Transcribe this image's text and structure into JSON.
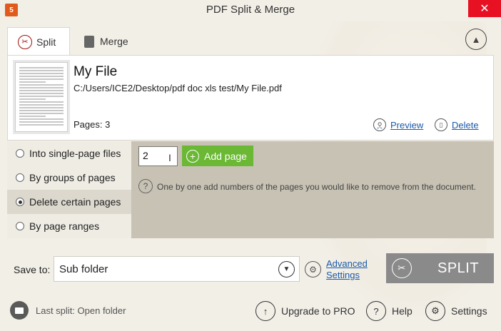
{
  "window": {
    "title": "PDF Split & Merge",
    "app_icon_label": "5"
  },
  "tabs": [
    {
      "label": "Split",
      "icon": "scissors-icon",
      "active": true
    },
    {
      "label": "Merge",
      "icon": "document-icon",
      "active": false
    }
  ],
  "file": {
    "name": "My File",
    "path": "C:/Users/ICE2/Desktop/pdf doc xls test/My File.pdf",
    "pages_label": "Pages: 3",
    "preview_label": "Preview",
    "delete_label": "Delete"
  },
  "modes": [
    {
      "label": "Into single-page files",
      "selected": false
    },
    {
      "label": "By groups of pages",
      "selected": false
    },
    {
      "label": "Delete certain pages",
      "selected": true
    },
    {
      "label": "By page ranges",
      "selected": false
    }
  ],
  "delete_pages": {
    "input_value": "2",
    "add_button_label": "Add page",
    "hint": "One by one add numbers of the pages you would like to remove from the document."
  },
  "save": {
    "label": "Save to:",
    "selected_option": "Sub folder",
    "advanced_line1": "Advanced",
    "advanced_line2": "Settings"
  },
  "split_button_label": "SPLIT",
  "footer": {
    "last_split": "Last split: Open folder",
    "upgrade": "Upgrade to PRO",
    "help": "Help",
    "settings": "Settings"
  },
  "colors": {
    "accent_green": "#6ab834",
    "close_red": "#e81123",
    "link_blue": "#1a5aa8",
    "split_gray": "#8a8a8a"
  }
}
